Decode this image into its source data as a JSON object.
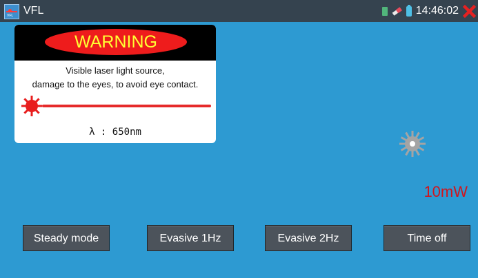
{
  "app": {
    "title": "VFL",
    "icon_label": "VFL"
  },
  "status": {
    "time": "14:46:02",
    "icons": [
      "sd-card-icon",
      "usb-icon",
      "battery-icon"
    ]
  },
  "warning": {
    "heading": "WARNING",
    "line1": "Visible laser light source,",
    "line2": "damage to the eyes, to avoid eye contact.",
    "wavelength": "λ : 650nm"
  },
  "laser": {
    "power": "10mW"
  },
  "buttons": {
    "steady": "Steady mode",
    "evasive1": "Evasive 1Hz",
    "evasive2": "Evasive 2Hz",
    "timeoff": "Time off"
  },
  "colors": {
    "background": "#2d9ad2",
    "titlebar": "#35434f",
    "warning_red": "#ee1c1c",
    "warning_text": "#ffff33",
    "power_text": "#d0161e",
    "button": "#4c535b"
  }
}
